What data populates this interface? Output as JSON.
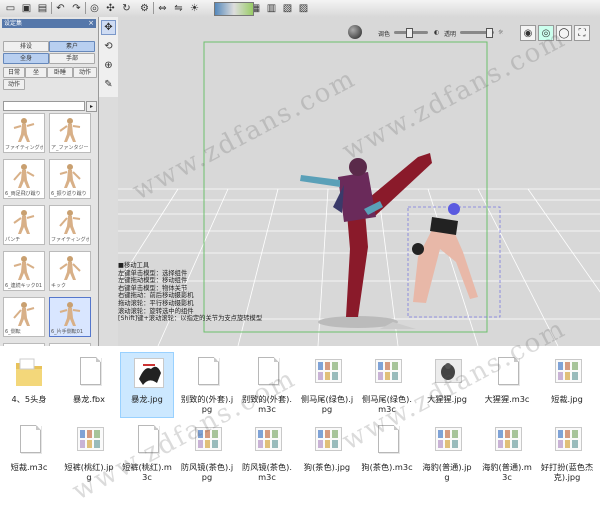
{
  "toolbar": {
    "buttons": [
      {
        "icon": "new-icon",
        "glyph": "▭"
      },
      {
        "icon": "open-icon",
        "glyph": "▣"
      },
      {
        "icon": "save-icon",
        "glyph": "▤"
      },
      {
        "icon": "undo-icon",
        "glyph": "↶"
      },
      {
        "icon": "redo-icon",
        "glyph": "↷"
      },
      {
        "icon": "camera-icon",
        "glyph": "◎"
      },
      {
        "icon": "joint-icon",
        "glyph": "✣"
      },
      {
        "icon": "reset-icon",
        "glyph": "↻"
      },
      {
        "icon": "settings-icon",
        "glyph": "⚙"
      },
      {
        "icon": "link-icon",
        "glyph": "⇔"
      },
      {
        "icon": "mirror-icon",
        "glyph": "⇋"
      },
      {
        "icon": "light-icon",
        "glyph": "☀"
      },
      {
        "icon": "layout-1-icon",
        "glyph": "▦"
      },
      {
        "icon": "layout-2-icon",
        "glyph": "▥"
      },
      {
        "icon": "layout-3-icon",
        "glyph": "▧"
      },
      {
        "icon": "layout-4-icon",
        "glyph": "▨"
      }
    ]
  },
  "panel": {
    "title": "设定集",
    "row1": [
      "排设",
      "素户"
    ],
    "row2": [
      "全身",
      "手部"
    ],
    "row3": [
      "日常",
      "坐",
      "卧睡",
      "动作"
    ],
    "row4": [
      "动作"
    ],
    "search_placeholder": "",
    "thumbs": [
      {
        "caption": "ファイティングポーズ"
      },
      {
        "caption": "ア_ファンタジー"
      },
      {
        "caption": "6_両足飛び蹴り"
      },
      {
        "caption": "6_振り返り蹴り"
      },
      {
        "caption": "パンチ"
      },
      {
        "caption": "ファイティングポーズ"
      },
      {
        "caption": "6_連続キック01"
      },
      {
        "caption": "キック"
      },
      {
        "caption": "6_側転"
      },
      {
        "caption": "6_片手側転01"
      },
      {
        "caption": ""
      },
      {
        "caption": ""
      }
    ]
  },
  "tools": [
    {
      "icon": "move-icon",
      "glyph": "✥"
    },
    {
      "icon": "rotate-icon",
      "glyph": "⟲"
    },
    {
      "icon": "scale-icon",
      "glyph": "⊕"
    },
    {
      "icon": "pen-icon",
      "glyph": "✎"
    }
  ],
  "viewport": {
    "contrast_label": "调色",
    "opacity_label": "透明",
    "help_lines": [
      "■移动工具",
      "左键单击模型：选择组件",
      "左键拖动模型：移动组件",
      "右键单击模型：物体关节",
      "右键拖动：前后移动摄影机",
      "拖动滚轮：平行移动摄影机",
      "滚动滚轮：旋转选中的组件",
      "[Shift]键+滚动滚轮：以指定的关节为支点旋转模型"
    ]
  },
  "explorer": {
    "row1": [
      {
        "name": "4、5头身",
        "type": "folder"
      },
      {
        "name": "暴龙.fbx",
        "type": "doc"
      },
      {
        "name": "暴龙.jpg",
        "type": "image",
        "selected": true
      },
      {
        "name": "别致的(外套).jpg",
        "type": "doc"
      },
      {
        "name": "别致的(外套).m3c",
        "type": "doc"
      },
      {
        "name": "侧马尾(绿色).jpg",
        "type": "sheet"
      },
      {
        "name": "侧马尾(绿色).m3c",
        "type": "sheet"
      },
      {
        "name": "大猩猩.jpg",
        "type": "photo"
      },
      {
        "name": "大猩猩.m3c",
        "type": "doc"
      },
      {
        "name": "短裁.jpg",
        "type": "sheet"
      }
    ],
    "row2": [
      {
        "name": "短裁.m3c",
        "type": "doc"
      },
      {
        "name": "短裤(桃红).jpg",
        "type": "sheet"
      },
      {
        "name": "短裤(桃红).m3c",
        "type": "doc"
      },
      {
        "name": "防风镜(茶色).jpg",
        "type": "sheet"
      },
      {
        "name": "防风镜(茶色).m3c",
        "type": "sheet"
      },
      {
        "name": "狗(茶色).jpg",
        "type": "sheet"
      },
      {
        "name": "狗(茶色).m3c",
        "type": "doc"
      },
      {
        "name": "海豹(普通).jpg",
        "type": "sheet"
      },
      {
        "name": "海豹(普通).m3c",
        "type": "sheet"
      },
      {
        "name": "好打扮(蓝色杰克).jpg",
        "type": "sheet"
      }
    ]
  },
  "watermark": "www.zdfans.com",
  "colors": {
    "accent": "#5577aa",
    "selected": "#cce8ff",
    "viewport_bg": "#d8d8d8"
  }
}
